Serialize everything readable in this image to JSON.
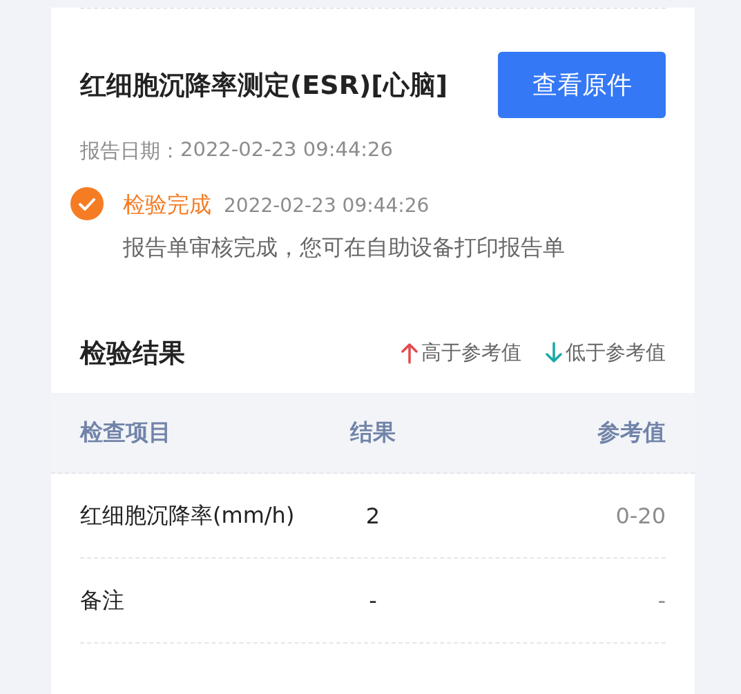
{
  "report": {
    "title": "红细胞沉降率测定(ESR)[心脑]",
    "view_button": "查看原件",
    "date_label": "报告日期：",
    "date": "2022-02-23 09:44:26"
  },
  "status": {
    "done": true,
    "label": "检验完成",
    "time": "2022-02-23 09:44:26",
    "message": "报告单审核完成，您可在自助设备打印报告单"
  },
  "results": {
    "title": "检验结果",
    "legend": [
      {
        "kind": "high",
        "label": "高于参考值"
      },
      {
        "kind": "low",
        "label": "低于参考值"
      }
    ],
    "columns": [
      "检查项目",
      "结果",
      "参考值"
    ],
    "rows": [
      {
        "item": "红细胞沉降率(mm/h)",
        "result": "2",
        "reference": "0-20"
      },
      {
        "item": "备注",
        "result": "-",
        "reference": "-"
      }
    ]
  }
}
